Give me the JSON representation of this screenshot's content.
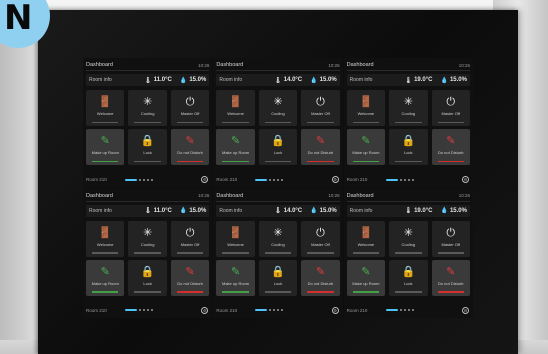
{
  "badge": {
    "letter": "N"
  },
  "panels": [
    {
      "title": "Dashboard",
      "time": "10:26",
      "room_info_label": "Room info",
      "temperature": "11.0°C",
      "humidity": "15.0%",
      "tiles": [
        {
          "label": "Welcome",
          "icon": "door-icon",
          "glyph": "🚪",
          "accent": "none",
          "active": false
        },
        {
          "label": "Cooling",
          "icon": "snowflake-icon",
          "glyph": "✳",
          "accent": "none",
          "active": false
        },
        {
          "label": "Master Off",
          "icon": "power-icon",
          "glyph": "⏻",
          "accent": "none",
          "active": false
        },
        {
          "label": "Make up Room",
          "icon": "cleaning-icon",
          "glyph": "✎",
          "accent": "green",
          "active": true
        },
        {
          "label": "Lock",
          "icon": "lock-icon",
          "glyph": "🔒",
          "accent": "none",
          "active": false
        },
        {
          "label": "Do not Disturb",
          "icon": "do-not-disturb-icon",
          "glyph": "✎",
          "accent": "red",
          "active": true
        }
      ],
      "room": "Room 210"
    },
    {
      "title": "Dashboard",
      "time": "10:26",
      "room_info_label": "Room info",
      "temperature": "14.0°C",
      "humidity": "15.0%",
      "tiles": [
        {
          "label": "Welcome",
          "icon": "door-icon",
          "glyph": "🚪",
          "accent": "none",
          "active": false
        },
        {
          "label": "Cooling",
          "icon": "snowflake-icon",
          "glyph": "✳",
          "accent": "none",
          "active": false
        },
        {
          "label": "Master Off",
          "icon": "power-icon",
          "glyph": "⏻",
          "accent": "none",
          "active": false
        },
        {
          "label": "Make up Room",
          "icon": "cleaning-icon",
          "glyph": "✎",
          "accent": "green",
          "active": true
        },
        {
          "label": "Lock",
          "icon": "lock-icon",
          "glyph": "🔒",
          "accent": "none",
          "active": false
        },
        {
          "label": "Do not Disturb",
          "icon": "do-not-disturb-icon",
          "glyph": "✎",
          "accent": "red",
          "active": true
        }
      ],
      "room": "Room 210"
    },
    {
      "title": "Dashboard",
      "time": "10:26",
      "room_info_label": "Room info",
      "temperature": "19.0°C",
      "humidity": "15.0%",
      "tiles": [
        {
          "label": "Welcome",
          "icon": "door-icon",
          "glyph": "🚪",
          "accent": "none",
          "active": false
        },
        {
          "label": "Cooling",
          "icon": "snowflake-icon",
          "glyph": "✳",
          "accent": "none",
          "active": false
        },
        {
          "label": "Master Off",
          "icon": "power-icon",
          "glyph": "⏻",
          "accent": "none",
          "active": false
        },
        {
          "label": "Make up Room",
          "icon": "cleaning-icon",
          "glyph": "✎",
          "accent": "green",
          "active": true
        },
        {
          "label": "Lock",
          "icon": "lock-icon",
          "glyph": "🔒",
          "accent": "none",
          "active": false
        },
        {
          "label": "Do not Disturb",
          "icon": "do-not-disturb-icon",
          "glyph": "✎",
          "accent": "red",
          "active": true
        }
      ],
      "room": "Room 210"
    },
    {
      "title": "Dashboard",
      "time": "10:26",
      "room_info_label": "Room info",
      "temperature": "11.0°C",
      "humidity": "15.0%",
      "tiles": [
        {
          "label": "Welcome",
          "icon": "door-icon",
          "glyph": "🚪",
          "accent": "none",
          "active": false
        },
        {
          "label": "Cooling",
          "icon": "snowflake-icon",
          "glyph": "✳",
          "accent": "none",
          "active": false
        },
        {
          "label": "Master Off",
          "icon": "power-icon",
          "glyph": "⏻",
          "accent": "none",
          "active": false
        },
        {
          "label": "Make up Room",
          "icon": "cleaning-icon",
          "glyph": "✎",
          "accent": "green",
          "active": true
        },
        {
          "label": "Lock",
          "icon": "lock-icon",
          "glyph": "🔒",
          "accent": "none",
          "active": false
        },
        {
          "label": "Do not Disturb",
          "icon": "do-not-disturb-icon",
          "glyph": "✎",
          "accent": "red",
          "active": true
        }
      ],
      "room": "Room 210"
    },
    {
      "title": "Dashboard",
      "time": "10:26",
      "room_info_label": "Room info",
      "temperature": "14.0°C",
      "humidity": "15.0%",
      "tiles": [
        {
          "label": "Welcome",
          "icon": "door-icon",
          "glyph": "🚪",
          "accent": "none",
          "active": false
        },
        {
          "label": "Cooling",
          "icon": "snowflake-icon",
          "glyph": "✳",
          "accent": "none",
          "active": false
        },
        {
          "label": "Master Off",
          "icon": "power-icon",
          "glyph": "⏻",
          "accent": "none",
          "active": false
        },
        {
          "label": "Make up Room",
          "icon": "cleaning-icon",
          "glyph": "✎",
          "accent": "green",
          "active": true
        },
        {
          "label": "Lock",
          "icon": "lock-icon",
          "glyph": "🔒",
          "accent": "none",
          "active": false
        },
        {
          "label": "Do not Disturb",
          "icon": "do-not-disturb-icon",
          "glyph": "✎",
          "accent": "red",
          "active": true
        }
      ],
      "room": "Room 210"
    },
    {
      "title": "Dashboard",
      "time": "10:26",
      "room_info_label": "Room info",
      "temperature": "19.0°C",
      "humidity": "15.0%",
      "tiles": [
        {
          "label": "Welcome",
          "icon": "door-icon",
          "glyph": "🚪",
          "accent": "none",
          "active": false
        },
        {
          "label": "Cooling",
          "icon": "snowflake-icon",
          "glyph": "✳",
          "accent": "none",
          "active": false
        },
        {
          "label": "Master Off",
          "icon": "power-icon",
          "glyph": "⏻",
          "accent": "none",
          "active": false
        },
        {
          "label": "Make up Room",
          "icon": "cleaning-icon",
          "glyph": "✎",
          "accent": "green",
          "active": true
        },
        {
          "label": "Lock",
          "icon": "lock-icon",
          "glyph": "🔒",
          "accent": "none",
          "active": false
        },
        {
          "label": "Do not Disturb",
          "icon": "do-not-disturb-icon",
          "glyph": "✎",
          "accent": "red",
          "active": true
        }
      ],
      "room": "Room 210"
    }
  ],
  "colors": {
    "accent_blue": "#4fc3f7",
    "green": "#43a047",
    "red": "#d32f2f",
    "badge": "#8fd0f0"
  }
}
